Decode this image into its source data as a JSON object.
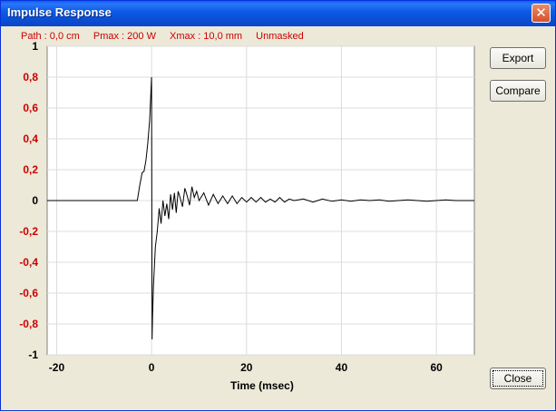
{
  "window": {
    "title": "Impulse Response",
    "close_glyph": "✕"
  },
  "status": {
    "path": "Path : 0,0 cm",
    "pmax": "Pmax : 200 W",
    "xmax": "Xmax : 10,0 mm",
    "mask": "Unmasked"
  },
  "buttons": {
    "export": "Export",
    "compare": "Compare",
    "close": "Close"
  },
  "colors": {
    "tick_red": "#cc0000",
    "tick_black": "#000000",
    "trace": "#000000"
  },
  "chart_data": {
    "type": "line",
    "xlabel": "Time (msec)",
    "ylabel": "",
    "xlim": [
      -22,
      68
    ],
    "ylim": [
      -1,
      1
    ],
    "grid": true,
    "xticks": [
      "-20",
      "0",
      "20",
      "40",
      "60"
    ],
    "yticks": [
      "1",
      "0,8",
      "0,6",
      "0,4",
      "0,2",
      "0",
      "-0,2",
      "-0,4",
      "-0,6",
      "-0,8",
      "-1"
    ],
    "series": [
      {
        "x": [
          -22,
          -3,
          -2.5,
          -2,
          -1.6,
          -1.2,
          -0.8,
          -0.4,
          0,
          0.1,
          0.2,
          0.4,
          0.8,
          1.2,
          1.6,
          2,
          2.4,
          2.8,
          3.2,
          3.6,
          4,
          4.4,
          4.8,
          5.2,
          5.6,
          6,
          6.5,
          7,
          7.5,
          8,
          8.5,
          9,
          9.5,
          10,
          11,
          12,
          13,
          14,
          15,
          16,
          17,
          18,
          19,
          20,
          21,
          22,
          23,
          24,
          25,
          26,
          27,
          28,
          29,
          30,
          32,
          34,
          36,
          38,
          40,
          42,
          44,
          46,
          48,
          50,
          52,
          54,
          56,
          58,
          60,
          62,
          64,
          66,
          68
        ],
        "y": [
          0,
          0,
          0.1,
          0.18,
          0.19,
          0.26,
          0.37,
          0.52,
          0.8,
          -0.9,
          -0.75,
          -0.55,
          -0.3,
          -0.2,
          -0.05,
          -0.15,
          0.0,
          -0.1,
          -0.02,
          -0.12,
          0.04,
          -0.06,
          0.05,
          -0.08,
          0.06,
          0.02,
          -0.04,
          0.08,
          0.03,
          -0.03,
          0.09,
          0.02,
          0.06,
          0.0,
          0.05,
          -0.03,
          0.04,
          -0.02,
          0.03,
          -0.02,
          0.03,
          -0.02,
          0.02,
          -0.01,
          0.02,
          -0.01,
          0.02,
          -0.01,
          0.01,
          -0.01,
          0.02,
          -0.01,
          0.01,
          0.0,
          0.01,
          -0.01,
          0.01,
          -0.005,
          0.005,
          -0.005,
          0.005,
          0,
          0.005,
          -0.005,
          0,
          0.005,
          0,
          -0.005,
          0,
          0.005,
          0,
          0,
          0
        ]
      }
    ]
  }
}
